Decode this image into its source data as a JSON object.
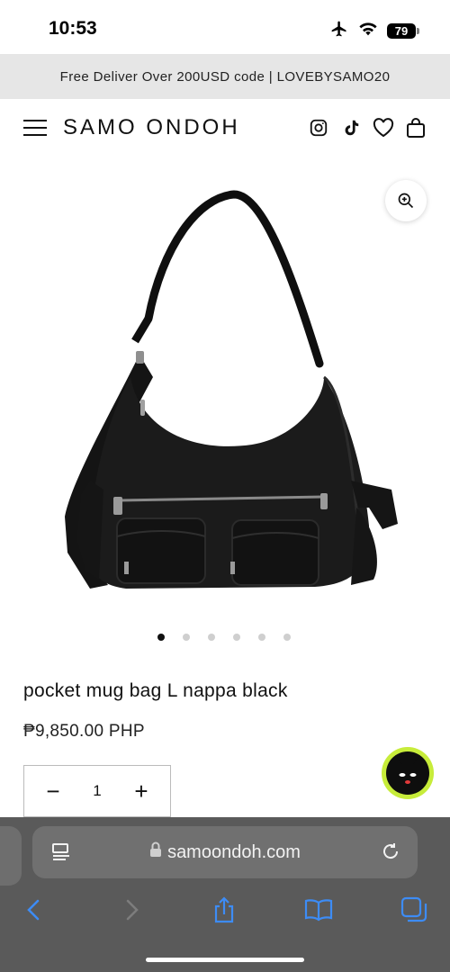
{
  "status": {
    "time": "10:53",
    "battery": "79"
  },
  "promo": {
    "text": "Free Deliver Over 200USD code | LOVEBYSAMO20"
  },
  "header": {
    "brand": "SAMO ONDOH"
  },
  "gallery": {
    "slide_count": 6,
    "active_slide": 1
  },
  "product": {
    "title": "pocket mug bag L nappa black",
    "price": "₱9,850.00 PHP",
    "quantity": "1",
    "minus": "−",
    "plus": "+"
  },
  "browser": {
    "url": "samoondoh.com"
  },
  "colors": {
    "chat_accent": "#c7ec3a",
    "safari_bar": "#5a5a5a",
    "ios_blue": "#3d8cf5"
  }
}
